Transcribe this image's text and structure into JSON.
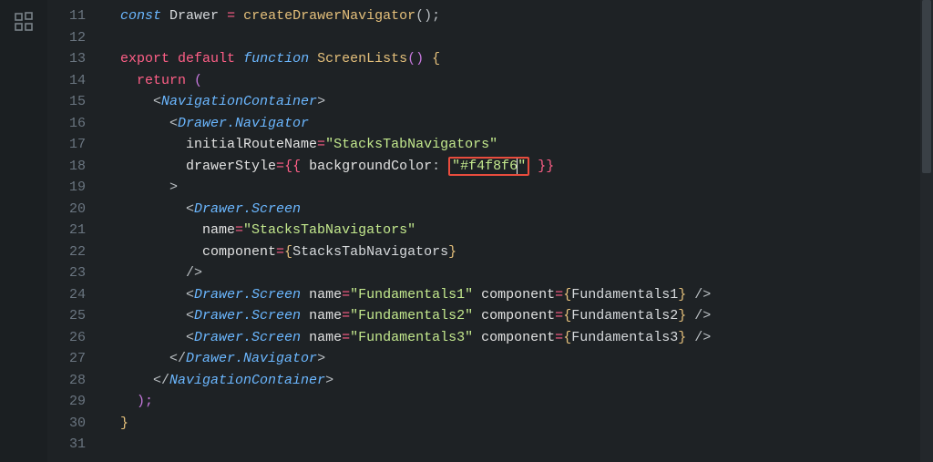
{
  "lineNumbers": [
    "11",
    "12",
    "13",
    "14",
    "15",
    "16",
    "17",
    "18",
    "19",
    "20",
    "21",
    "22",
    "23",
    "24",
    "25",
    "26",
    "27",
    "28",
    "29",
    "30",
    "31"
  ],
  "code": {
    "l11": {
      "const": "const",
      "Drawer": "Drawer",
      "eq": "=",
      "fn": "createDrawerNavigator",
      "call": "();"
    },
    "l13": {
      "export": "export",
      "default": "default",
      "function": "function",
      "name": "ScreenLists",
      "paren": "()",
      "brace": "{"
    },
    "l14": {
      "return": "return",
      "paren": "("
    },
    "l15": {
      "open": "<",
      "tag": "NavigationContainer",
      "close": ">"
    },
    "l16": {
      "open": "<",
      "tag": "Drawer.Navigator"
    },
    "l17": {
      "attr": "initialRouteName",
      "eq": "=",
      "val": "\"StacksTabNavigators\""
    },
    "l18": {
      "attr": "drawerStyle",
      "eq": "=",
      "ob": "{{",
      "key": "backgroundColor",
      "colon": ":",
      "q": "\"",
      "val": "#f4f8f6",
      "cb": "}}"
    },
    "l19": {
      "gt": ">"
    },
    "l20": {
      "open": "<",
      "tag": "Drawer.Screen"
    },
    "l21": {
      "attr": "name",
      "eq": "=",
      "val": "\"StacksTabNavigators\""
    },
    "l22": {
      "attr": "component",
      "eq": "=",
      "ob": "{",
      "val": "StacksTabNavigators",
      "cb": "}"
    },
    "l23": {
      "selfclose": "/>"
    },
    "l24": {
      "open": "<",
      "tag": "Drawer.Screen",
      "a1": "name",
      "eq1": "=",
      "v1": "\"Fundamentals1\"",
      "a2": "component",
      "eq2": "=",
      "ob": "{",
      "v2": "Fundamentals1",
      "cb": "}",
      "selfclose": "/>"
    },
    "l25": {
      "open": "<",
      "tag": "Drawer.Screen",
      "a1": "name",
      "eq1": "=",
      "v1": "\"Fundamentals2\"",
      "a2": "component",
      "eq2": "=",
      "ob": "{",
      "v2": "Fundamentals2",
      "cb": "}",
      "selfclose": "/>"
    },
    "l26": {
      "open": "<",
      "tag": "Drawer.Screen",
      "a1": "name",
      "eq1": "=",
      "v1": "\"Fundamentals3\"",
      "a2": "component",
      "eq2": "=",
      "ob": "{",
      "v2": "Fundamentals3",
      "cb": "}",
      "selfclose": "/>"
    },
    "l27": {
      "open": "</",
      "tag": "Drawer.Navigator",
      "close": ">"
    },
    "l28": {
      "open": "</",
      "tag": "NavigationContainer",
      "close": ">"
    },
    "l29": {
      "text": ");"
    },
    "l30": {
      "text": "}"
    }
  },
  "scrollMark": "T"
}
